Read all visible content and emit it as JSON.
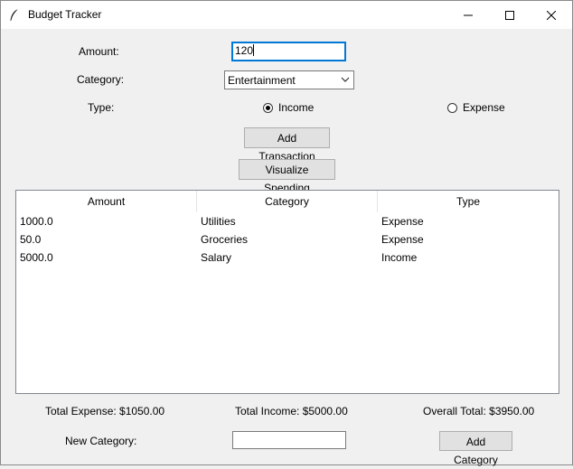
{
  "window": {
    "title": "Budget Tracker",
    "app_icon": "feather-icon",
    "controls": [
      "minimize-icon",
      "maximize-icon",
      "close-icon"
    ]
  },
  "form": {
    "amount_label": "Amount:",
    "amount_value": "120",
    "category_label": "Category:",
    "category_value": "Entertainment",
    "type_label": "Type:",
    "type_options": [
      "Income",
      "Expense"
    ],
    "type_selected": "Income"
  },
  "buttons": {
    "add_transaction": "Add Transaction",
    "visualize": "Visualize Spending",
    "add_category": "Add Category"
  },
  "table": {
    "columns": [
      "Amount",
      "Category",
      "Type"
    ],
    "rows": [
      [
        "1000.0",
        "Utilities",
        "Expense"
      ],
      [
        "50.0",
        "Groceries",
        "Expense"
      ],
      [
        "5000.0",
        "Salary",
        "Income"
      ]
    ]
  },
  "totals": {
    "expense": "Total Expense: $1050.00",
    "income": "Total Income: $5000.00",
    "overall": "Overall Total: $3950.00"
  },
  "new_category": {
    "label": "New Category:",
    "value": ""
  },
  "colors": {
    "window_bg": "#f0f0f0",
    "focus_border": "#0078d7",
    "button_bg": "#e1e1e1"
  }
}
